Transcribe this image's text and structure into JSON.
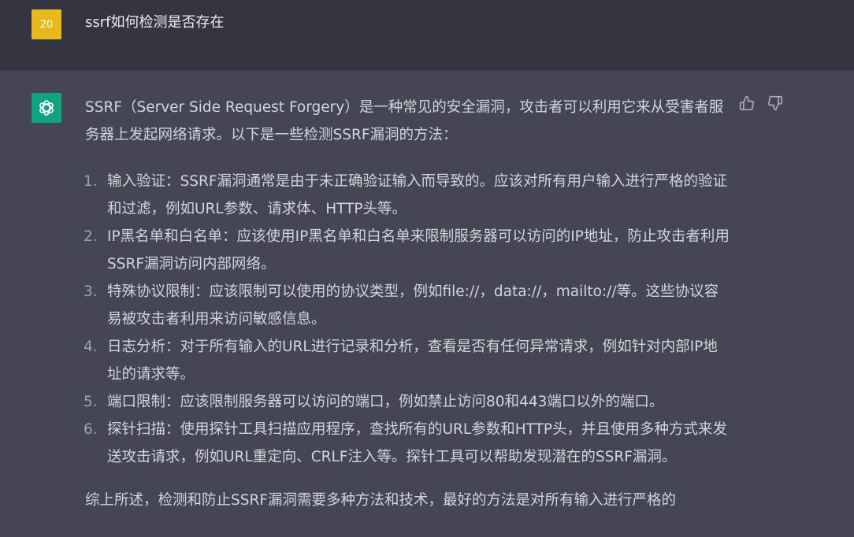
{
  "user": {
    "avatar_label": "20",
    "message": "ssrf如何检测是否存在"
  },
  "assistant": {
    "intro": "SSRF（Server Side Request Forgery）是一种常见的安全漏洞，攻击者可以利用它来从受害者服务器上发起网络请求。以下是一些检测SSRF漏洞的方法：",
    "items": [
      {
        "number": "1.",
        "text": "输入验证：SSRF漏洞通常是由于未正确验证输入而导致的。应该对所有用户输入进行严格的验证和过滤，例如URL参数、请求体、HTTP头等。"
      },
      {
        "number": "2.",
        "text": "IP黑名单和白名单：应该使用IP黑名单和白名单来限制服务器可以访问的IP地址，防止攻击者利用SSRF漏洞访问内部网络。"
      },
      {
        "number": "3.",
        "text": "特殊协议限制：应该限制可以使用的协议类型，例如file://，data://，mailto://等。这些协议容易被攻击者利用来访问敏感信息。"
      },
      {
        "number": "4.",
        "text": "日志分析：对于所有输入的URL进行记录和分析，查看是否有任何异常请求，例如针对内部IP地址的请求等。"
      },
      {
        "number": "5.",
        "text": "端口限制：应该限制服务器可以访问的端口，例如禁止访问80和443端口以外的端口。"
      },
      {
        "number": "6.",
        "text": "探针扫描：使用探针工具扫描应用程序，查找所有的URL参数和HTTP头，并且使用多种方式来发送攻击请求，例如URL重定向、CRLF注入等。探针工具可以帮助发现潜在的SSRF漏洞。"
      }
    ],
    "summary": "综上所述，检测和防止SSRF漏洞需要多种方法和技术，最好的方法是对所有输入进行严格的"
  },
  "icons": {
    "assistant_logo": "openai-logo-icon",
    "thumbs_up": "thumbs-up-icon",
    "thumbs_down": "thumbs-down-icon"
  },
  "colors": {
    "user_row_bg": "#343541",
    "assistant_row_bg": "#444654",
    "user_avatar_bg": "#e8b91a",
    "assistant_avatar_bg": "#10a37f",
    "text": "#d1d5db"
  }
}
